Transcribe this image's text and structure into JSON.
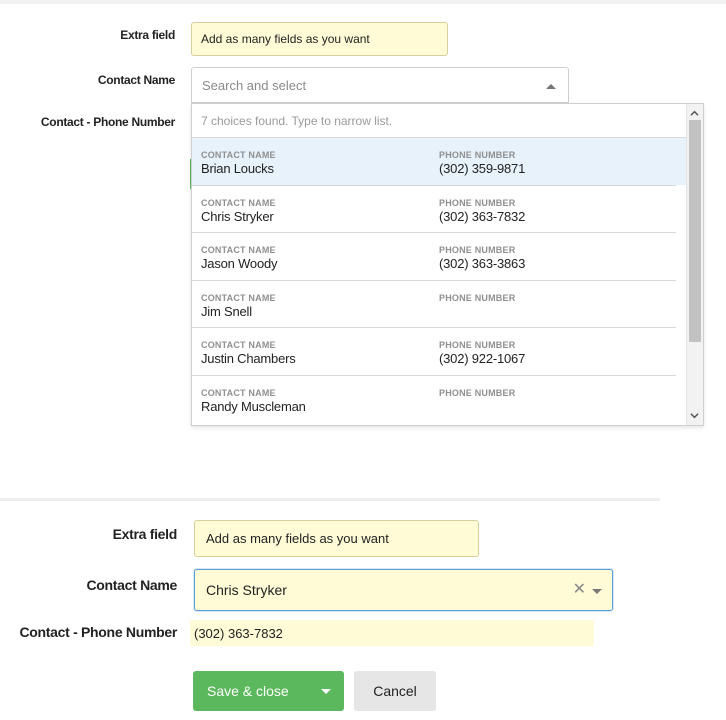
{
  "top_form": {
    "extra_field_label": "Extra field",
    "extra_field_value": "Add as many fields as you want",
    "contact_name_label": "Contact Name",
    "contact_name_placeholder": "Search and select",
    "phone_label": "Contact - Phone Number"
  },
  "dropdown": {
    "count_text": "7 choices found. Type to narrow list.",
    "col1_caption": "CONTACT NAME",
    "col2_caption": "PHONE NUMBER",
    "items": [
      {
        "name": "Brian Loucks",
        "phone": "(302) 359-9871",
        "active": true
      },
      {
        "name": "Chris Stryker",
        "phone": "(302) 363-7832"
      },
      {
        "name": "Jason Woody",
        "phone": "(302) 363-3863"
      },
      {
        "name": "Jim Snell",
        "phone": ""
      },
      {
        "name": "Justin Chambers",
        "phone": "(302) 922-1067"
      },
      {
        "name": "Randy Muscleman",
        "phone": ""
      }
    ]
  },
  "bottom_form": {
    "extra_field_label": "Extra field",
    "extra_field_value": "Add as many fields as you want",
    "contact_name_label": "Contact Name",
    "contact_name_value": "Chris Stryker",
    "phone_label": "Contact - Phone Number",
    "phone_value": "(302) 363-7832"
  },
  "actions": {
    "save_label": "Save & close",
    "cancel_label": "Cancel"
  },
  "icons": {
    "clear": "clear-icon",
    "caret": "caret-down-icon",
    "scroll_up": "scroll-up-icon",
    "scroll_down": "scroll-down-icon"
  },
  "colors": {
    "primary": "#5cb85c",
    "field_bg": "#fffbd6",
    "active_row": "#e7f2fb",
    "focus_border": "#5aa0d8"
  }
}
